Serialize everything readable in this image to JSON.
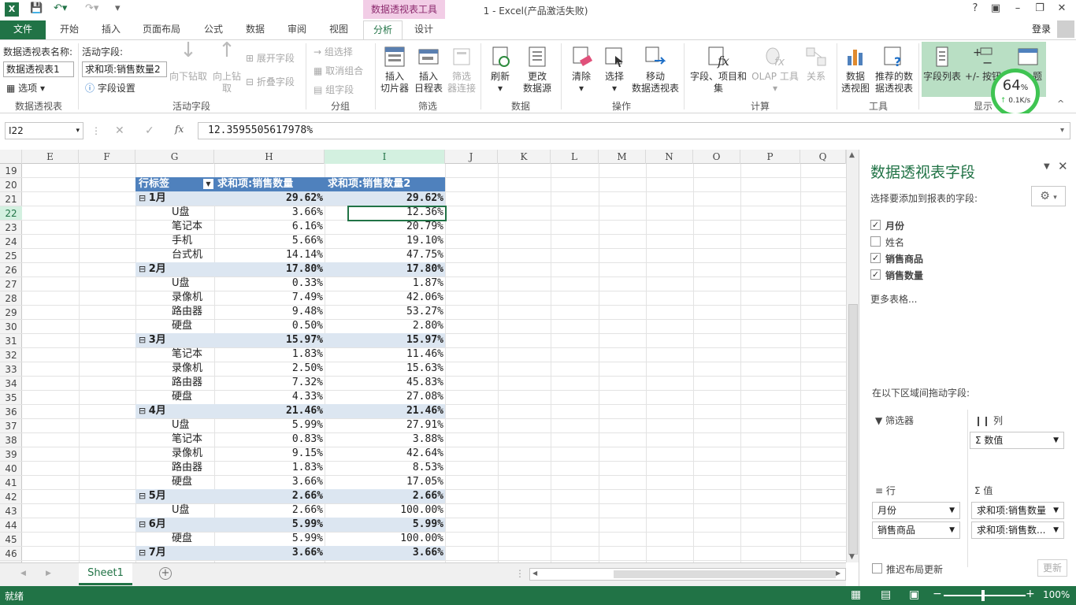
{
  "title_bar": {
    "ctx_title": "数据透视表工具",
    "doc_title": "1 - Excel(产品激活失败)",
    "login": "登录",
    "help": "?"
  },
  "tabs": {
    "file": "文件",
    "home": "开始",
    "insert": "插入",
    "layout": "页面布局",
    "formulas": "公式",
    "data": "数据",
    "review": "审阅",
    "view": "视图",
    "analyze": "分析",
    "design": "设计"
  },
  "ribbon": {
    "pt_name_label": "数据透视表名称:",
    "pt_name": "数据透视表1",
    "options": "选项",
    "active_field_label": "活动字段:",
    "active_field": "求和项:销售数量2",
    "field_settings": "字段设置",
    "drill_down": "向下钻取",
    "drill_up": "向上钻\n取",
    "expand": "展开字段",
    "collapse": "折叠字段",
    "group_sel": "组选择",
    "ungroup": "取消组合",
    "group_field": "组字段",
    "slicer": "插入\n切片器",
    "timeline": "插入\n日程表",
    "filter_conn": "筛选\n器连接",
    "refresh": "刷新",
    "change_source": "更改\n数据源",
    "clear": "清除",
    "select": "选择",
    "move": "移动\n数据透视表",
    "fields_items": "字段、项目和\n集",
    "olap": "OLAP 工具",
    "relations": "关系",
    "pivotchart": "数据\n透视图",
    "recommended": "推荐的数\n据透视表",
    "field_list": "字段列表",
    "plusminus": "+/- 按钮",
    "headers": "题",
    "groups": {
      "pivot": "数据透视表",
      "active": "活动字段",
      "group": "分组",
      "filter": "筛选",
      "data": "数据",
      "actions": "操作",
      "calc": "计算",
      "tools": "工具",
      "show": "显示"
    }
  },
  "speed": {
    "percent": "64",
    "unit": "%",
    "rate": "0.1K/s"
  },
  "formula_bar": {
    "cell": "I22",
    "value": "12.3595505617978%"
  },
  "columns": [
    "E",
    "F",
    "G",
    "H",
    "I",
    "J",
    "K",
    "L",
    "M",
    "N",
    "O",
    "P",
    "Q"
  ],
  "rows": [
    "19",
    "20",
    "21",
    "22",
    "23",
    "24",
    "25",
    "26",
    "27",
    "28",
    "29",
    "30",
    "31",
    "32",
    "33",
    "34",
    "35",
    "36",
    "37",
    "38",
    "39",
    "40",
    "41",
    "42",
    "43",
    "44",
    "45",
    "46"
  ],
  "pivot": {
    "headers": [
      "行标签",
      "求和项:销售数量",
      "求和项:销售数量2"
    ],
    "rows": [
      {
        "type": "month",
        "label": "1月",
        "h": "29.62%",
        "i": "29.62%"
      },
      {
        "type": "item",
        "label": "U盘",
        "h": "3.66%",
        "i": "12.36%"
      },
      {
        "type": "item",
        "label": "笔记本",
        "h": "6.16%",
        "i": "20.79%"
      },
      {
        "type": "item",
        "label": "手机",
        "h": "5.66%",
        "i": "19.10%"
      },
      {
        "type": "item",
        "label": "台式机",
        "h": "14.14%",
        "i": "47.75%"
      },
      {
        "type": "month",
        "label": "2月",
        "h": "17.80%",
        "i": "17.80%"
      },
      {
        "type": "item",
        "label": "U盘",
        "h": "0.33%",
        "i": "1.87%"
      },
      {
        "type": "item",
        "label": "录像机",
        "h": "7.49%",
        "i": "42.06%"
      },
      {
        "type": "item",
        "label": "路由器",
        "h": "9.48%",
        "i": "53.27%"
      },
      {
        "type": "item",
        "label": "硬盘",
        "h": "0.50%",
        "i": "2.80%"
      },
      {
        "type": "month",
        "label": "3月",
        "h": "15.97%",
        "i": "15.97%"
      },
      {
        "type": "item",
        "label": "笔记本",
        "h": "1.83%",
        "i": "11.46%"
      },
      {
        "type": "item",
        "label": "录像机",
        "h": "2.50%",
        "i": "15.63%"
      },
      {
        "type": "item",
        "label": "路由器",
        "h": "7.32%",
        "i": "45.83%"
      },
      {
        "type": "item",
        "label": "硬盘",
        "h": "4.33%",
        "i": "27.08%"
      },
      {
        "type": "month",
        "label": "4月",
        "h": "21.46%",
        "i": "21.46%"
      },
      {
        "type": "item",
        "label": "U盘",
        "h": "5.99%",
        "i": "27.91%"
      },
      {
        "type": "item",
        "label": "笔记本",
        "h": "0.83%",
        "i": "3.88%"
      },
      {
        "type": "item",
        "label": "录像机",
        "h": "9.15%",
        "i": "42.64%"
      },
      {
        "type": "item",
        "label": "路由器",
        "h": "1.83%",
        "i": "8.53%"
      },
      {
        "type": "item",
        "label": "硬盘",
        "h": "3.66%",
        "i": "17.05%"
      },
      {
        "type": "month",
        "label": "5月",
        "h": "2.66%",
        "i": "2.66%"
      },
      {
        "type": "item",
        "label": "U盘",
        "h": "2.66%",
        "i": "100.00%"
      },
      {
        "type": "month",
        "label": "6月",
        "h": "5.99%",
        "i": "5.99%"
      },
      {
        "type": "item",
        "label": "硬盘",
        "h": "5.99%",
        "i": "100.00%"
      },
      {
        "type": "month",
        "label": "7月",
        "h": "3.66%",
        "i": "3.66%"
      }
    ]
  },
  "sheet": {
    "tab": "Sheet1"
  },
  "status": {
    "ready": "就绪",
    "zoom": "100%"
  },
  "pane": {
    "title": "数据透视表字段",
    "subtitle": "选择要添加到报表的字段:",
    "fields": [
      {
        "label": "月份",
        "checked": true
      },
      {
        "label": "姓名",
        "checked": false
      },
      {
        "label": "销售商品",
        "checked": true
      },
      {
        "label": "销售数量",
        "checked": true
      }
    ],
    "more_tables": "更多表格...",
    "drag_label": "在以下区域间拖动字段:",
    "filters": "筛选器",
    "columns": "列",
    "rows": "行",
    "values": "值",
    "col_item": "数值",
    "row_items": [
      "月份",
      "销售商品"
    ],
    "value_items": [
      "求和项:销售数量",
      "求和项:销售数..."
    ],
    "defer": "推迟布局更新",
    "update": "更新"
  },
  "colors": {
    "accent": "#217346",
    "pivot_header": "#4f81bd",
    "month_row": "#dce6f1",
    "context": "#f2cde6"
  }
}
